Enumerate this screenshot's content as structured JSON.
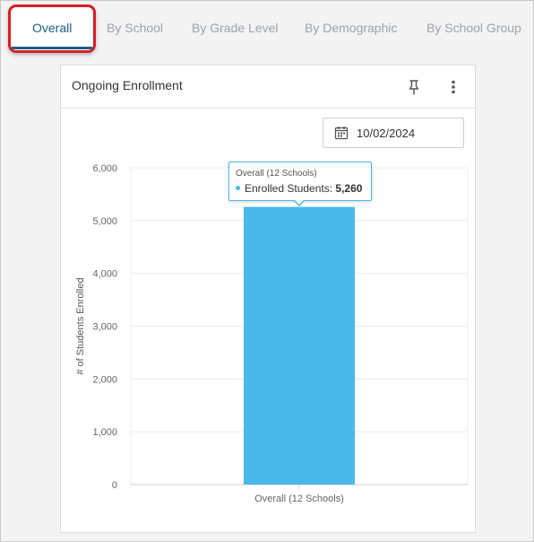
{
  "tabs": [
    {
      "label": "Overall",
      "active": true
    },
    {
      "label": "By School"
    },
    {
      "label": "By Grade Level"
    },
    {
      "label": "By Demographic"
    },
    {
      "label": "By School Group"
    }
  ],
  "card": {
    "title": "Ongoing Enrollment",
    "pin_icon": "pin-icon",
    "menu_icon": "more-vertical-icon"
  },
  "date_picker": {
    "icon": "calendar-icon",
    "value": "10/02/2024"
  },
  "tooltip": {
    "header": "Overall (12 Schools)",
    "series_label": "Enrolled Students:",
    "value": "5,260"
  },
  "colors": {
    "accent": "#1f5f86",
    "bar": "#49b8ea",
    "highlight": "#d61f26"
  },
  "chart_data": {
    "type": "bar",
    "categories": [
      "Overall (12 Schools)"
    ],
    "series": [
      {
        "name": "Enrolled Students",
        "values": [
          5260
        ]
      }
    ],
    "ylabel": "# of Students Enrolled",
    "xlabel": "",
    "ylim": [
      0,
      6000
    ],
    "yticks": [
      "0",
      "1,000",
      "2,000",
      "3,000",
      "4,000",
      "5,000",
      "6,000"
    ],
    "grid": true
  }
}
